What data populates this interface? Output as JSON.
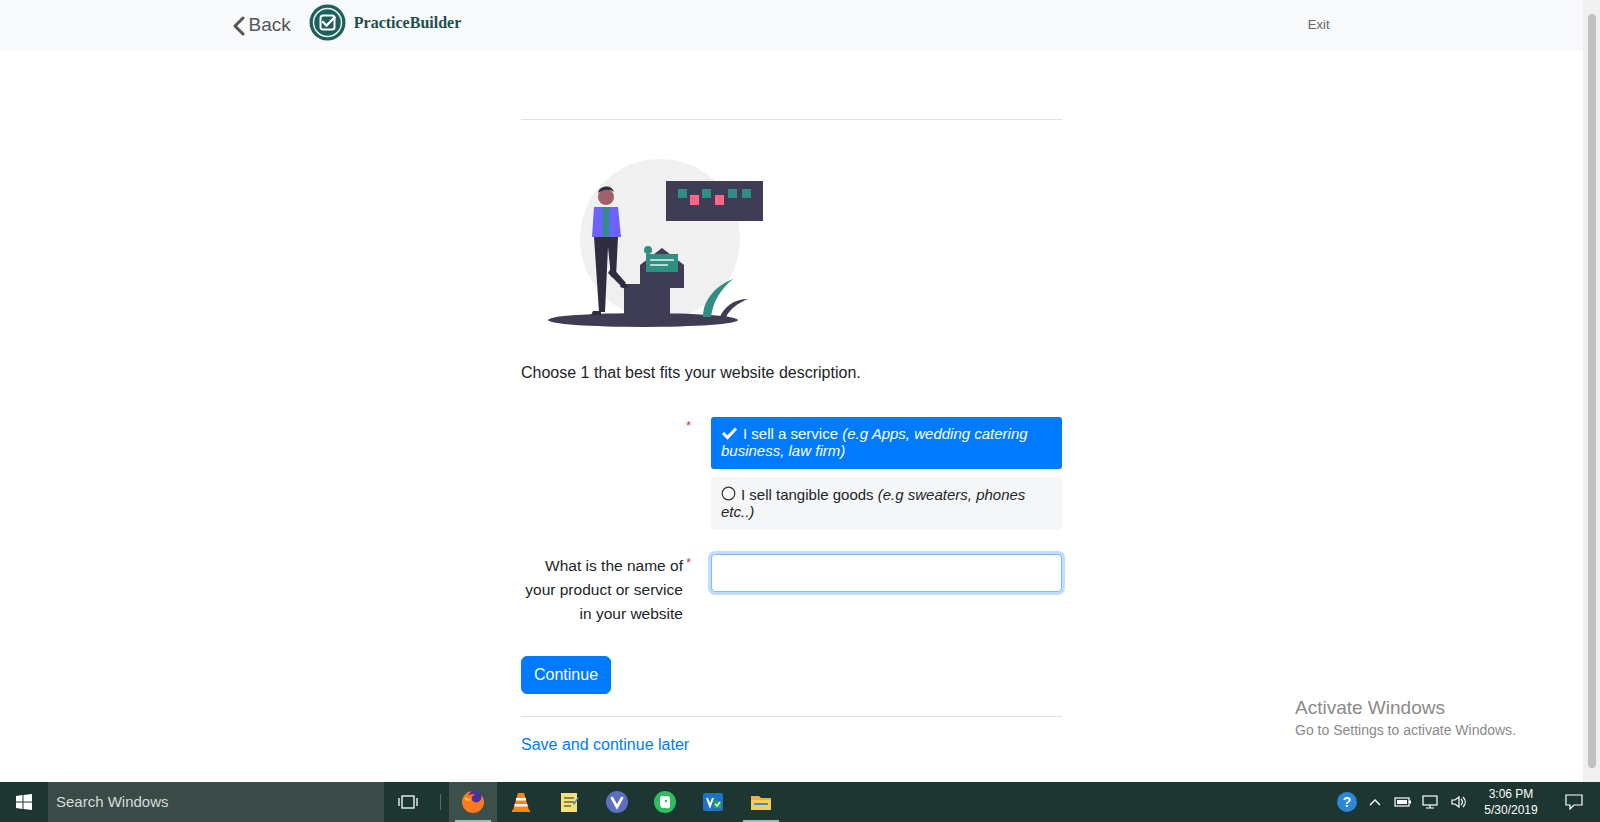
{
  "header": {
    "back": "Back",
    "brand": "PracticeBuilder",
    "exit": "Exit"
  },
  "form": {
    "prompt": "Choose 1 that best fits your website description.",
    "type_required_mark": "*",
    "options": [
      {
        "label": "I sell a service",
        "example": "(e.g Apps, wedding catering business, law firm)",
        "selected": true
      },
      {
        "label": "I sell tangible goods",
        "example": "(e.g sweaters, phones etc..)",
        "selected": false
      }
    ],
    "name_field": {
      "label": "What is the name of your product or service in your website",
      "required_mark": "*",
      "value": "",
      "focused": true
    },
    "continue": "Continue",
    "save_later": "Save and continue later"
  },
  "watermark": {
    "title": "Activate Windows",
    "subtitle": "Go to Settings to activate Windows."
  },
  "taskbar": {
    "search_placeholder": "Search Windows",
    "apps": [
      {
        "kind": "firefox",
        "running": true,
        "active": true
      },
      {
        "kind": "vlc",
        "running": false,
        "active": false
      },
      {
        "kind": "notes",
        "running": false,
        "active": false
      },
      {
        "kind": "vivaldi",
        "running": false,
        "active": false
      },
      {
        "kind": "evernote",
        "running": false,
        "active": false
      },
      {
        "kind": "editor",
        "running": false,
        "active": false
      },
      {
        "kind": "explorer",
        "running": true,
        "active": false
      }
    ],
    "help": "?",
    "time": "3:06 PM",
    "date": "5/30/2019"
  }
}
